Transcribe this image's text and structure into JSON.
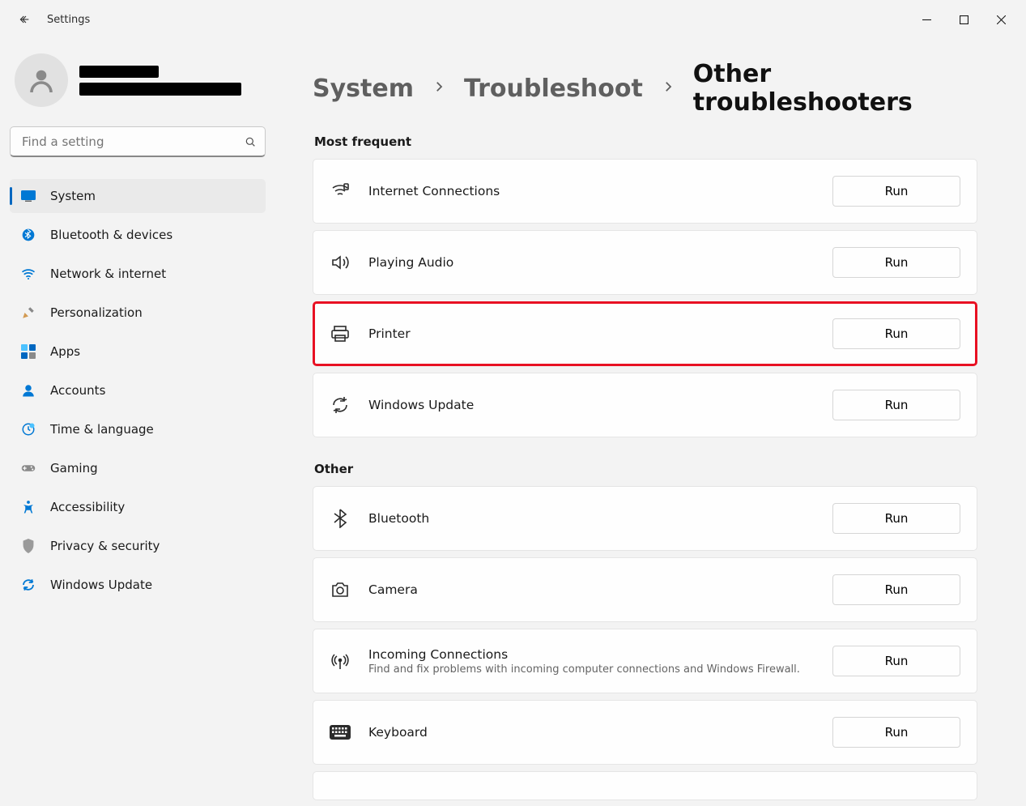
{
  "window": {
    "title": "Settings"
  },
  "search": {
    "placeholder": "Find a setting"
  },
  "sidebar": {
    "items": [
      {
        "id": "system",
        "label": "System",
        "selected": true
      },
      {
        "id": "bluetooth",
        "label": "Bluetooth & devices",
        "selected": false
      },
      {
        "id": "network",
        "label": "Network & internet",
        "selected": false
      },
      {
        "id": "personalization",
        "label": "Personalization",
        "selected": false
      },
      {
        "id": "apps",
        "label": "Apps",
        "selected": false
      },
      {
        "id": "accounts",
        "label": "Accounts",
        "selected": false
      },
      {
        "id": "time",
        "label": "Time & language",
        "selected": false
      },
      {
        "id": "gaming",
        "label": "Gaming",
        "selected": false
      },
      {
        "id": "accessibility",
        "label": "Accessibility",
        "selected": false
      },
      {
        "id": "privacy",
        "label": "Privacy & security",
        "selected": false
      },
      {
        "id": "winupdate",
        "label": "Windows Update",
        "selected": false
      }
    ]
  },
  "breadcrumb": {
    "items": [
      {
        "label": "System"
      },
      {
        "label": "Troubleshoot"
      },
      {
        "label": "Other troubleshooters"
      }
    ]
  },
  "run_label": "Run",
  "sections": [
    {
      "title": "Most frequent",
      "items": [
        {
          "id": "internet",
          "label": "Internet Connections",
          "icon": "wifi",
          "highlight": false
        },
        {
          "id": "audio",
          "label": "Playing Audio",
          "icon": "speaker",
          "highlight": false
        },
        {
          "id": "printer",
          "label": "Printer",
          "icon": "printer",
          "highlight": true
        },
        {
          "id": "wupdate",
          "label": "Windows Update",
          "icon": "refresh",
          "highlight": false
        }
      ]
    },
    {
      "title": "Other",
      "items": [
        {
          "id": "bt",
          "label": "Bluetooth",
          "icon": "bluetooth",
          "highlight": false
        },
        {
          "id": "camera",
          "label": "Camera",
          "icon": "camera",
          "highlight": false
        },
        {
          "id": "incoming",
          "label": "Incoming Connections",
          "sublabel": "Find and fix problems with incoming computer connections and Windows Firewall.",
          "icon": "antenna",
          "highlight": false
        },
        {
          "id": "keyboard",
          "label": "Keyboard",
          "icon": "keyboard",
          "highlight": false
        }
      ]
    }
  ]
}
